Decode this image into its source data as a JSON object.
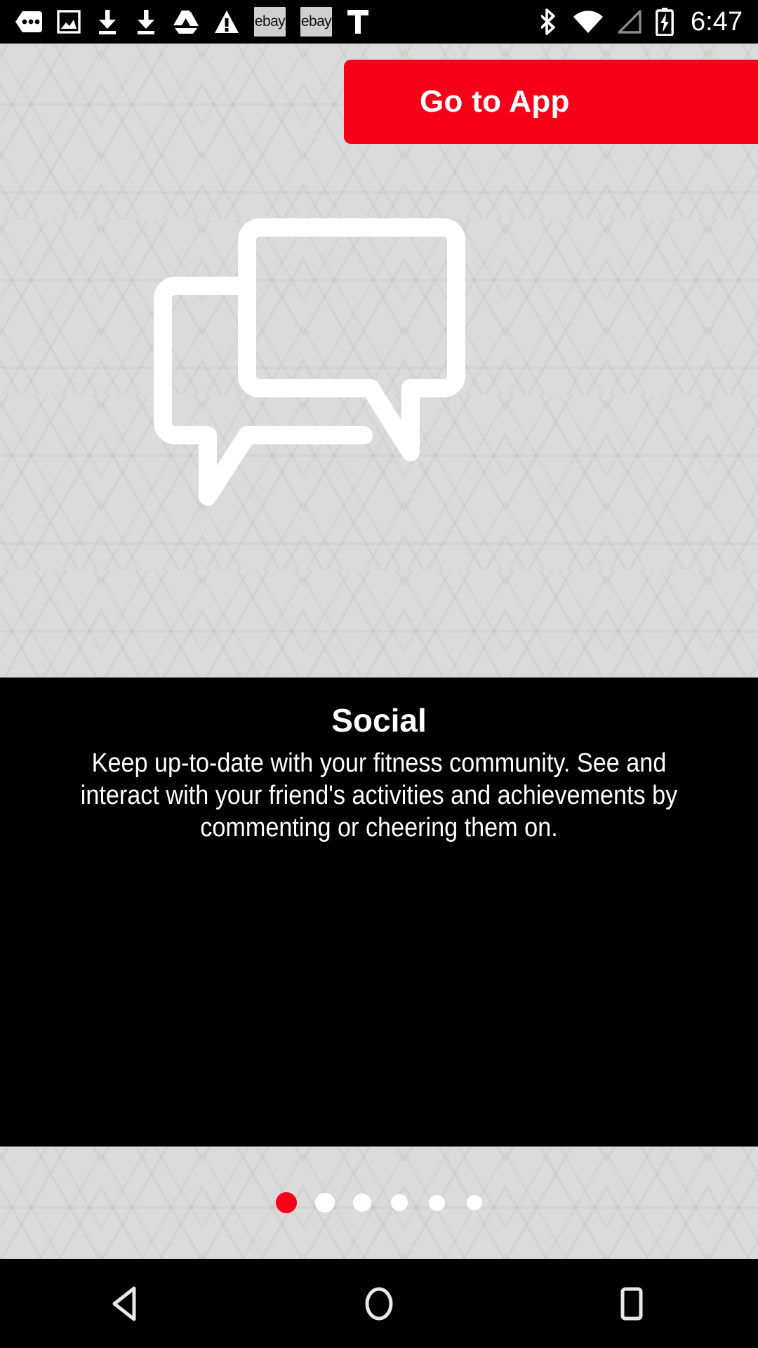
{
  "status_bar": {
    "notifications": [
      {
        "name": "more-notifications-icon",
        "label": "more"
      },
      {
        "name": "image-icon",
        "label": "image"
      },
      {
        "name": "download-icon",
        "label": "download"
      },
      {
        "name": "download-icon",
        "label": "download"
      },
      {
        "name": "google-drive-icon",
        "label": "drive"
      },
      {
        "name": "warning-icon",
        "label": "warning"
      },
      {
        "name": "ebay-badge-icon",
        "label": "ebay"
      },
      {
        "name": "ebay-badge-icon",
        "label": "ebay"
      },
      {
        "name": "text-t-icon",
        "label": "T"
      }
    ],
    "ebay_label": "ebay",
    "t_label": "T",
    "system": [
      {
        "name": "bluetooth-icon",
        "label": "bluetooth"
      },
      {
        "name": "wifi-icon",
        "label": "wifi"
      },
      {
        "name": "cellular-signal-icon",
        "label": "no signal"
      },
      {
        "name": "battery-charging-icon",
        "label": "charging"
      }
    ],
    "clock": "6:47"
  },
  "hero": {
    "go_to_app_label": "Go to App",
    "illustration_name": "chat-bubbles-illustration"
  },
  "content": {
    "title": "Social",
    "description": "Keep up-to-date with your fitness community. See and interact with your friend's activities and achievements by commenting or cheering them on."
  },
  "page_indicator": {
    "total": 6,
    "active_index": 0,
    "dots": [
      {
        "active": true,
        "size": 30,
        "gap": 0
      },
      {
        "active": false,
        "size": 28,
        "gap": 26
      },
      {
        "active": false,
        "size": 26,
        "gap": 26
      },
      {
        "active": false,
        "size": 24,
        "gap": 28
      },
      {
        "active": false,
        "size": 23,
        "gap": 30
      },
      {
        "active": false,
        "size": 22,
        "gap": 31
      }
    ]
  },
  "nav_bar": {
    "buttons": [
      {
        "name": "back-button",
        "label": "Back"
      },
      {
        "name": "home-button",
        "label": "Home"
      },
      {
        "name": "recents-button",
        "label": "Recents"
      }
    ]
  },
  "colors": {
    "accent_red": "#f50018",
    "panel_black": "#000000",
    "hero_gray": "#dbdbdb",
    "white": "#ffffff"
  }
}
